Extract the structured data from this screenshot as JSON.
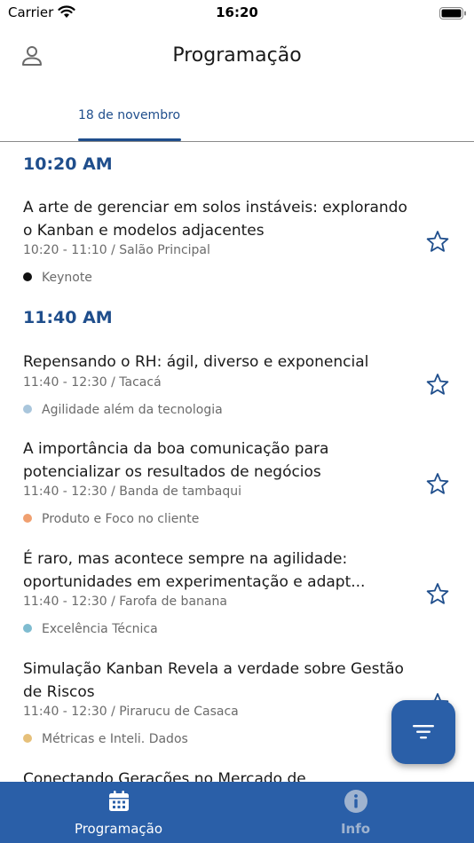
{
  "status_bar": {
    "carrier": "Carrier",
    "time": "16:20",
    "wifi_icon": "wifi-icon",
    "battery_icon": "battery-icon"
  },
  "header": {
    "title": "Programação",
    "profile_icon": "person-icon"
  },
  "tabs": [
    {
      "label": "18 de novembro",
      "selected": true
    }
  ],
  "colors": {
    "accent": "#1f4e8c",
    "nav_background": "#2a5fa8",
    "keynote": "#111111",
    "agilidade": "#a9c6dc",
    "produto": "#f0a070",
    "excelencia": "#7fbcd0",
    "metricas": "#e6c07a"
  },
  "schedule": [
    {
      "time_header": "10:20 AM",
      "sessions": [
        {
          "title": "A arte de gerenciar em solos instáveis: explorando o Kanban e modelos adjacentes",
          "start": "10:20",
          "end": " - 11:10",
          "room": "/ Salão Principal",
          "track": "Keynote",
          "track_color": "#111111"
        }
      ]
    },
    {
      "time_header": "11:40 AM",
      "sessions": [
        {
          "title": "Repensando o RH: ágil, diverso e exponencial",
          "start": "11:40",
          "end": " - 12:30",
          "room": "/ Tacacá",
          "track": "Agilidade além da tecnologia",
          "track_color": "#a9c6dc"
        },
        {
          "title": "A importância da boa comunicação para potencializar os resultados de negócios",
          "start": "11:40",
          "end": " - 12:30",
          "room": "/ Banda de tambaqui",
          "track": "Produto e Foco no cliente",
          "track_color": "#f0a070"
        },
        {
          "title": "É raro, mas acontece sempre na agilidade: oportunidades em experimentação e adapt...",
          "start": "11:40",
          "end": " - 12:30",
          "room": "/ Farofa de banana",
          "track": "Excelência Técnica",
          "track_color": "#7fbcd0"
        },
        {
          "title": "Simulação Kanban Revela a verdade sobre Gestão de Riscos",
          "start": "11:40",
          "end": " - 12:30",
          "room": "/ Pirarucu de Casaca",
          "track": "Métricas e Inteli. Dados",
          "track_color": "#e6c07a"
        },
        {
          "title": "Conectando Gerações no Mercado de"
        }
      ]
    }
  ],
  "fab": {
    "icon": "filter-icon"
  },
  "bottom_nav": [
    {
      "label": "Programação",
      "icon": "calendar-icon",
      "active": true
    },
    {
      "label": "Info",
      "icon": "info-icon",
      "active": false
    }
  ]
}
